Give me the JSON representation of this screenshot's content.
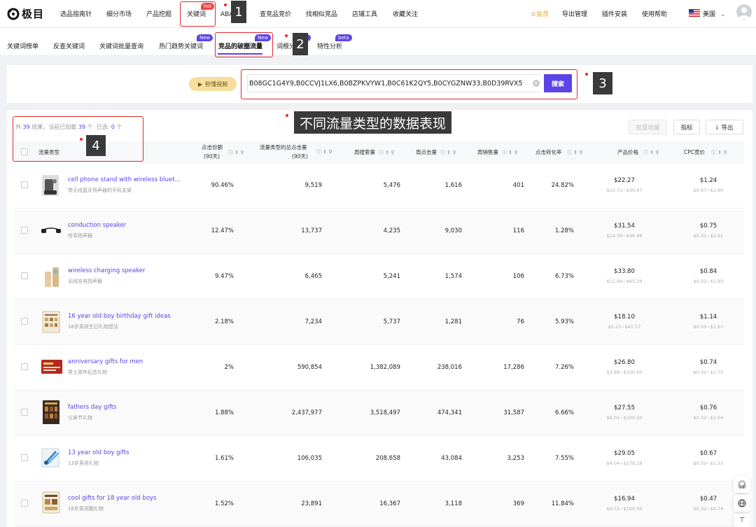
{
  "brand": {
    "logo_text": "极目"
  },
  "nav": {
    "items": [
      {
        "label": "选品指南针"
      },
      {
        "label": "细分市场"
      },
      {
        "label": "产品挖掘"
      },
      {
        "label": "关键词"
      },
      {
        "label": "ABA榜单"
      },
      {
        "label": "查竞品竞价"
      },
      {
        "label": "找相似竞品"
      },
      {
        "label": "店铺工具"
      },
      {
        "label": "收藏关注"
      }
    ],
    "hot_badge": "hot",
    "right": {
      "vip": "会员",
      "export": "导出管理",
      "plugin": "插件安装",
      "help": "使用帮助",
      "region": "美国"
    }
  },
  "subnav": {
    "items": [
      {
        "label": "关键词榜单"
      },
      {
        "label": "反查关键词"
      },
      {
        "label": "关键词批量查询"
      },
      {
        "label": "热门趋势关键词"
      },
      {
        "label": "竞品的破圈流量"
      },
      {
        "label": "词根分析"
      },
      {
        "label": "特性分析"
      }
    ],
    "badge_new": "New",
    "badge_beta": "beta"
  },
  "search": {
    "video_btn": "秒懂视频",
    "value": "B08GC1G4Y9,B0CCVJ1LX6,B0BZPKVYW1,B0C61K2QY5,B0CYGZNW33,B0D39RVX5",
    "button": "搜索"
  },
  "summary": {
    "prefix": "共",
    "total": "39",
    "mid": "结果，当前已加载",
    "loaded": "39",
    "unit": "个",
    "sel_label": "已选:",
    "selected": "0",
    "sel_unit": "个"
  },
  "toolbar": {
    "batch_collect": "批量收藏",
    "metrics": "指标",
    "export": "导出"
  },
  "table": {
    "headers": {
      "type": "流量类型",
      "share": "点击份额",
      "share_sub": "(90天)",
      "total_clicks": "流量类型的总点击量",
      "total_clicks_sub": "(90天)",
      "weekly_search": "周搜索量",
      "weekly_clicks": "周点击量",
      "weekly_sales": "周销售量",
      "ctr": "点击转化率",
      "price": "产品价格",
      "cpc": "CPC竞价"
    },
    "rows": [
      {
        "kw": "cell phone stand with wireless bluet...",
        "kw_cn": "带无线蓝牙扬声器的手机支架",
        "share": "90.46%",
        "total": "9,519",
        "search": "5,476",
        "clicks": "1,616",
        "sales": "401",
        "ctr": "24.82%",
        "price": "$22.27",
        "price_range": "$10.71~$30.47",
        "cpc": "$1.24",
        "cpc_range": "$0.67~$1.90"
      },
      {
        "kw": "conduction speaker",
        "kw_cn": "传导扬声器",
        "share": "12.47%",
        "total": "13,737",
        "search": "4,235",
        "clicks": "9,030",
        "sales": "116",
        "ctr": "1.28%",
        "price": "$31.54",
        "price_range": "$14.39~$96.98",
        "cpc": "$0.75",
        "cpc_range": "$0.32~$2.61"
      },
      {
        "kw": "wireless charging speaker",
        "kw_cn": "无线充电扬声器",
        "share": "9.47%",
        "total": "6,465",
        "search": "5,241",
        "clicks": "1,574",
        "sales": "106",
        "ctr": "6.73%",
        "price": "$33.80",
        "price_range": "$11.94~$65.29",
        "cpc": "$0.84",
        "cpc_range": "$0.32~$1.93"
      },
      {
        "kw": "16 year old boy birthday gift ideas",
        "kw_cn": "16岁男孩生日礼物想法",
        "share": "2.18%",
        "total": "7,234",
        "search": "5,737",
        "clicks": "1,281",
        "sales": "76",
        "ctr": "5.93%",
        "price": "$18.10",
        "price_range": "$5.23~$41.57",
        "cpc": "$1.14",
        "cpc_range": "$0.50~$1.67"
      },
      {
        "kw": "anniversary gifts for men",
        "kw_cn": "男士周年纪念礼物",
        "share": "2%",
        "total": "590,854",
        "search": "1,382,089",
        "clicks": "238,016",
        "sales": "17,286",
        "ctr": "7.26%",
        "price": "$26.80",
        "price_range": "$3.89~$100.50",
        "cpc": "$0.74",
        "cpc_range": "$0.32~$1.75"
      },
      {
        "kw": "fathers day gifts",
        "kw_cn": "父亲节礼物",
        "share": "1.88%",
        "total": "2,437,977",
        "search": "3,518,497",
        "clicks": "474,341",
        "sales": "31,587",
        "ctr": "6.66%",
        "price": "$27.55",
        "price_range": "$6.01~$100.50",
        "cpc": "$0.76",
        "cpc_range": "$0.32~$1.54"
      },
      {
        "kw": "13 year old boy gifts",
        "kw_cn": "13岁男孩礼物",
        "share": "1.61%",
        "total": "106,035",
        "search": "208,658",
        "clicks": "43,084",
        "sales": "3,253",
        "ctr": "7.55%",
        "price": "$29.05",
        "price_range": "$4.04~$178.19",
        "cpc": "$0.67",
        "cpc_range": "$0.32~$1.23"
      },
      {
        "kw": "cool gifts for 18 year old boys",
        "kw_cn": "18岁男孩酷礼物",
        "share": "1.52%",
        "total": "23,891",
        "search": "16,367",
        "clicks": "3,118",
        "sales": "369",
        "ctr": "11.84%",
        "price": "$16.94",
        "price_range": "$4.72~$100.50",
        "cpc": "$0.47",
        "cpc_range": "$0.32~$0.74"
      }
    ]
  },
  "annotations": {
    "n1": "1",
    "n2": "2",
    "n3": "3",
    "n4": "4",
    "label": "不同流量类型的数据表现"
  },
  "icons": {
    "help": "help-circle-icon",
    "sort": "sort-icon",
    "filter": "filter-icon",
    "chevron": "chevron-down-icon",
    "export": "export-icon",
    "video": "video-icon",
    "support": "headset-icon",
    "globe": "globe-icon",
    "top": "back-to-top-icon"
  },
  "colors": {
    "accent": "#5b43e8",
    "hot": "#f04545",
    "annotation": "#e8262a",
    "vip": "#e8a317"
  }
}
